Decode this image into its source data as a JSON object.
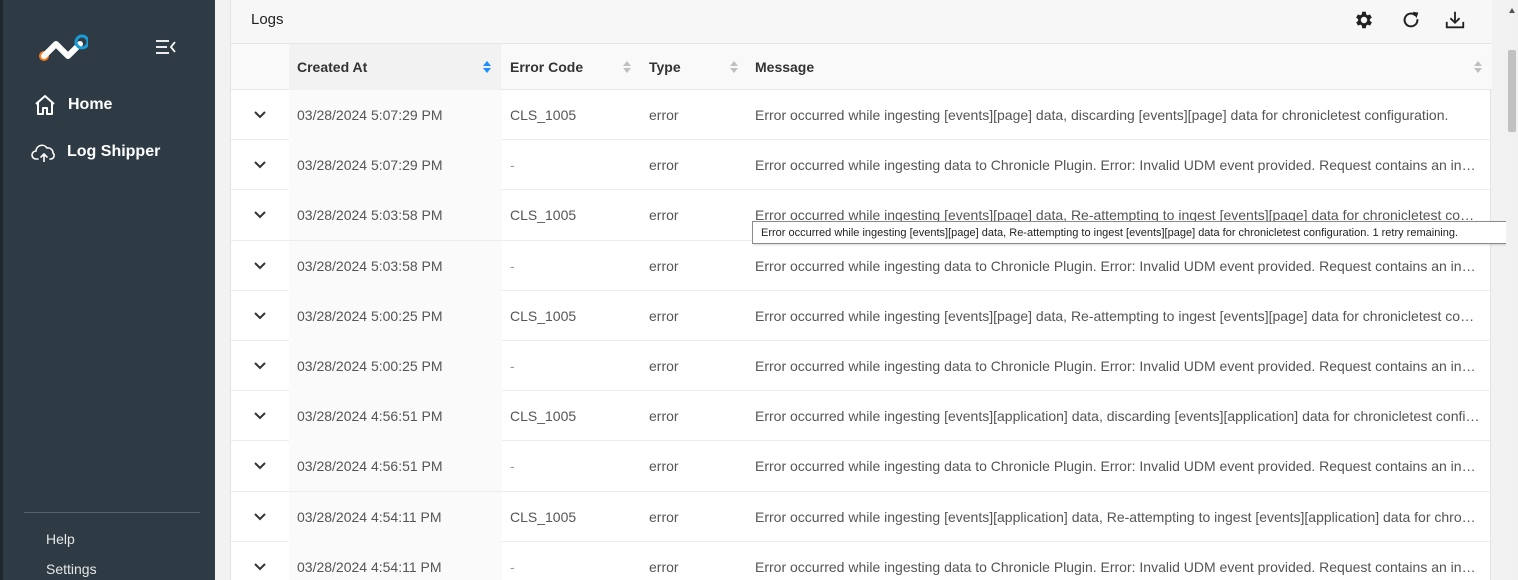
{
  "sidebar": {
    "nav": [
      {
        "label": "Home",
        "icon": "home-icon"
      },
      {
        "label": "Log Shipper",
        "icon": "cloud-icon"
      }
    ],
    "footer": {
      "help": "Help",
      "settings": "Settings"
    }
  },
  "panel": {
    "title": "Logs",
    "columns": {
      "created_at": "Created At",
      "error_code": "Error Code",
      "type": "Type",
      "message": "Message"
    }
  },
  "rows": [
    {
      "created_at": "03/28/2024 5:07:29 PM",
      "error_code": "CLS_1005",
      "type": "error",
      "message": "Error occurred while ingesting [events][page] data, discarding [events][page] data for chronicletest configuration."
    },
    {
      "created_at": "03/28/2024 5:07:29 PM",
      "error_code": "-",
      "type": "error",
      "message": "Error occurred while ingesting data to Chronicle Plugin. Error: Invalid UDM event provided. Request contains an invali..."
    },
    {
      "created_at": "03/28/2024 5:03:58 PM",
      "error_code": "CLS_1005",
      "type": "error",
      "message": "Error occurred while ingesting [events][page] data, Re-attempting to ingest [events][page] data for chronicletest confi..."
    },
    {
      "created_at": "03/28/2024 5:03:58 PM",
      "error_code": "-",
      "type": "error",
      "message": "Error occurred while ingesting data to Chronicle Plugin. Error: Invalid UDM event provided. Request contains an invali..."
    },
    {
      "created_at": "03/28/2024 5:00:25 PM",
      "error_code": "CLS_1005",
      "type": "error",
      "message": "Error occurred while ingesting [events][page] data, Re-attempting to ingest [events][page] data for chronicletest confi..."
    },
    {
      "created_at": "03/28/2024 5:00:25 PM",
      "error_code": "-",
      "type": "error",
      "message": "Error occurred while ingesting data to Chronicle Plugin. Error: Invalid UDM event provided. Request contains an invali..."
    },
    {
      "created_at": "03/28/2024 4:56:51 PM",
      "error_code": "CLS_1005",
      "type": "error",
      "message": "Error occurred while ingesting [events][application] data, discarding [events][application] data for chronicletest config..."
    },
    {
      "created_at": "03/28/2024 4:56:51 PM",
      "error_code": "-",
      "type": "error",
      "message": "Error occurred while ingesting data to Chronicle Plugin. Error: Invalid UDM event provided. Request contains an invali..."
    },
    {
      "created_at": "03/28/2024 4:54:11 PM",
      "error_code": "CLS_1005",
      "type": "error",
      "message": "Error occurred while ingesting [events][application] data, Re-attempting to ingest [events][application] data for chroni..."
    },
    {
      "created_at": "03/28/2024 4:54:11 PM",
      "error_code": "-",
      "type": "error",
      "message": "Error occurred while ingesting data to Chronicle Plugin. Error: Invalid UDM event provided. Request contains an invali..."
    }
  ],
  "tooltip": "Error occurred while ingesting [events][page] data, Re-attempting to ingest [events][page] data for chronicletest configuration. 1 retry remaining.",
  "colors": {
    "sidebar": "#2f3b44",
    "logo_orange": "#f47b20",
    "logo_blue": "#1a9ad6",
    "sort_active": "#1890ff"
  }
}
